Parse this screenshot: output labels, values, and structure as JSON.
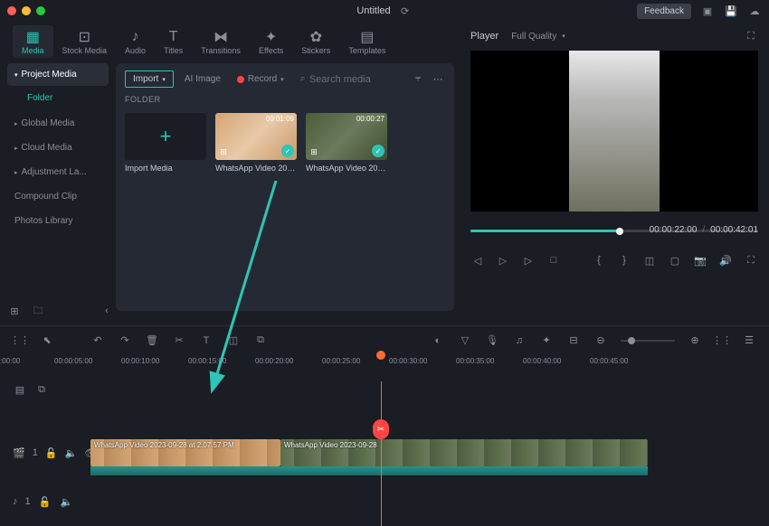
{
  "titlebar": {
    "title": "Untitled",
    "feedback": "Feedback"
  },
  "tabs": [
    {
      "label": "Media",
      "icon": "📁"
    },
    {
      "label": "Stock Media",
      "icon": "🎞"
    },
    {
      "label": "Audio",
      "icon": "♪"
    },
    {
      "label": "Titles",
      "icon": "T"
    },
    {
      "label": "Transitions",
      "icon": "◈"
    },
    {
      "label": "Effects",
      "icon": "✦"
    },
    {
      "label": "Stickers",
      "icon": "☻"
    },
    {
      "label": "Templates",
      "icon": "▦"
    }
  ],
  "sidebar": {
    "items": [
      {
        "label": "Project Media",
        "active": true
      },
      {
        "label": "Global Media"
      },
      {
        "label": "Cloud Media"
      },
      {
        "label": "Adjustment La..."
      },
      {
        "label": "Compound Clip"
      },
      {
        "label": "Photos Library"
      }
    ],
    "folder": "Folder"
  },
  "toolbar": {
    "import": "Import",
    "ai_image": "AI Image",
    "record": "Record",
    "search_placeholder": "Search media"
  },
  "folder_header": "FOLDER",
  "media": [
    {
      "name": "Import Media",
      "type": "import"
    },
    {
      "name": "WhatsApp Video 202...",
      "duration": "00:01:09"
    },
    {
      "name": "WhatsApp Video 202...",
      "duration": "00:00:27"
    }
  ],
  "player": {
    "label": "Player",
    "quality": "Full Quality",
    "current_time": "00:00:22:00",
    "total_time": "00:00:42:01"
  },
  "timeline": {
    "ticks": [
      ":00:00",
      "00:00:05:00",
      "00:00:10:00",
      "00:00:15:00",
      "00:00:20:00",
      "00:00:25:00",
      "00:00:30:00",
      "00:00:35:00",
      "00:00:40:00",
      "00:00:45:00"
    ],
    "clip1_label": "WhatsApp Video 2023-09-28 at 2.07.57 PM",
    "clip2_label": "WhatsApp Video 2023-09-28",
    "video_track": "1",
    "audio_track": "1"
  }
}
